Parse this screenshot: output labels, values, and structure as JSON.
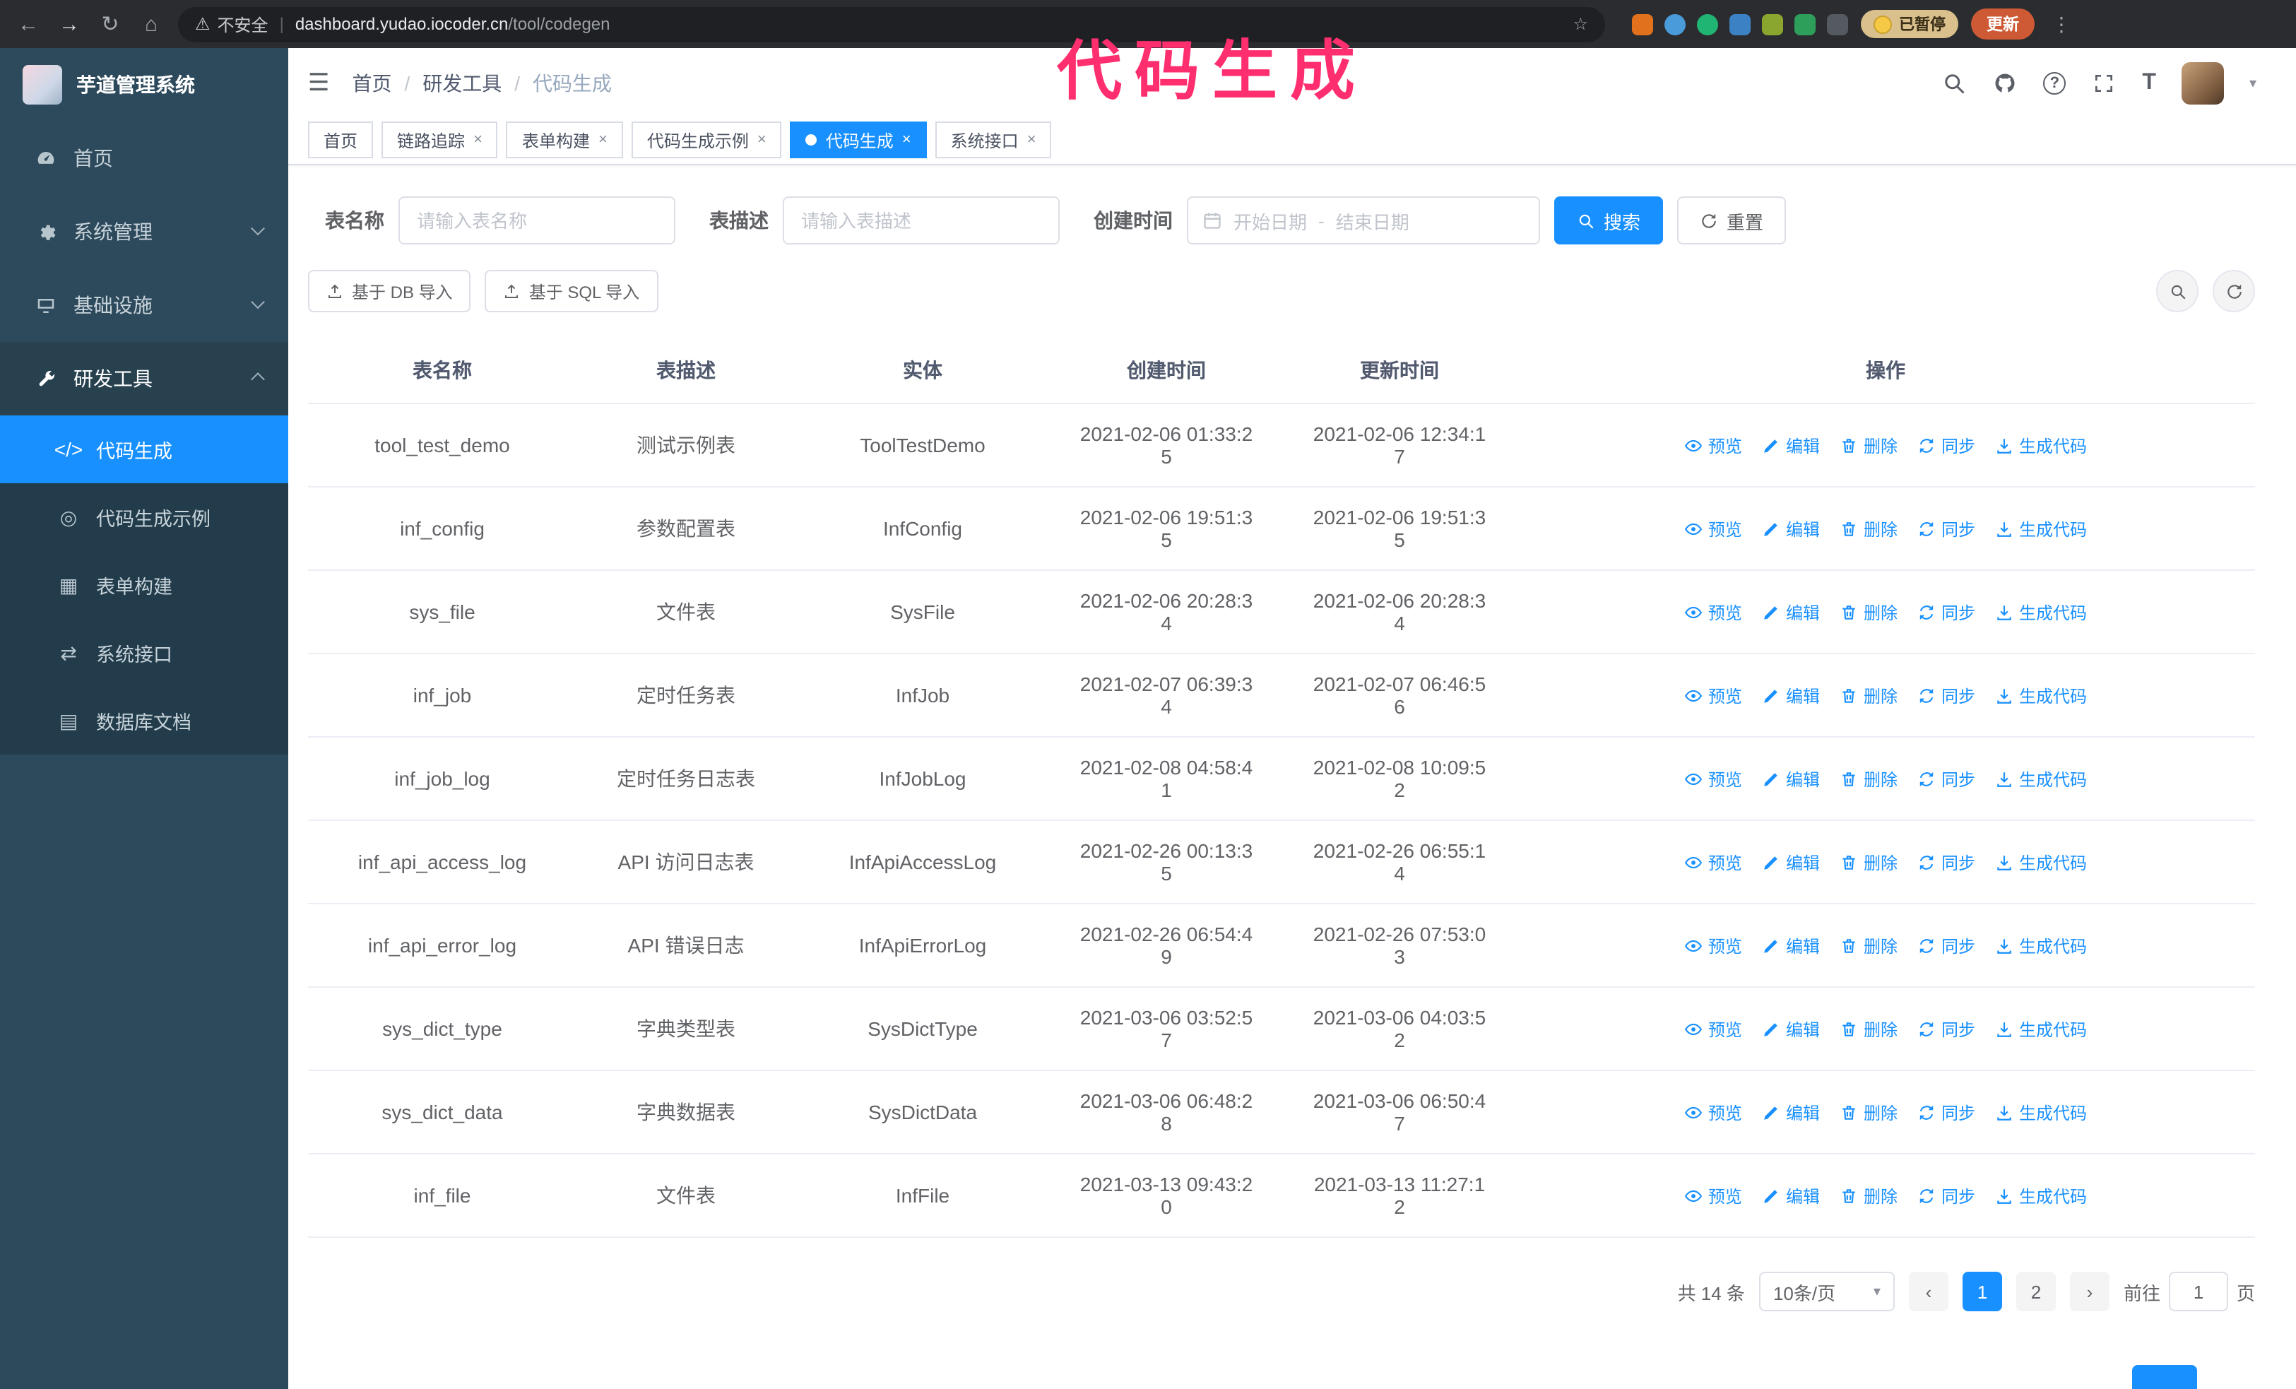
{
  "browser": {
    "warning_text": "不安全",
    "url_host": "dashboard.yudao.iocoder.cn",
    "url_path": "/tool/codegen",
    "paused_badge": "已暂停",
    "update_button": "更新",
    "extensions": [
      "#e2711d",
      "#4a9bd9",
      "#21b573",
      "#3b82c4",
      "#8aa62f",
      "#2e9e5b",
      "#555a60"
    ]
  },
  "annotation": {
    "text": "代码生成",
    "color": "#ff2e6e"
  },
  "sidebar": {
    "logo_title": "芋道管理系统",
    "items": [
      {
        "label": "首页",
        "icon": "dashboard"
      },
      {
        "label": "系统管理",
        "icon": "gear",
        "chevron": "down"
      },
      {
        "label": "基础设施",
        "icon": "infra",
        "chevron": "down"
      },
      {
        "label": "研发工具",
        "icon": "tools",
        "chevron": "up"
      }
    ],
    "subitems": [
      {
        "label": "代码生成",
        "icon": "code",
        "active": true
      },
      {
        "label": "代码生成示例",
        "icon": "example"
      },
      {
        "label": "表单构建",
        "icon": "form"
      },
      {
        "label": "系统接口",
        "icon": "api"
      },
      {
        "label": "数据库文档",
        "icon": "db"
      }
    ]
  },
  "header": {
    "breadcrumb": [
      "首页",
      "研发工具",
      "代码生成"
    ]
  },
  "tabs": [
    {
      "label": "首页",
      "closable": false
    },
    {
      "label": "链路追踪",
      "closable": true
    },
    {
      "label": "表单构建",
      "closable": true
    },
    {
      "label": "代码生成示例",
      "closable": true
    },
    {
      "label": "代码生成",
      "closable": true,
      "active": true
    },
    {
      "label": "系统接口",
      "closable": true
    }
  ],
  "filters": {
    "table_name_label": "表名称",
    "table_name_placeholder": "请输入表名称",
    "table_desc_label": "表描述",
    "table_desc_placeholder": "请输入表描述",
    "create_time_label": "创建时间",
    "date_start_placeholder": "开始日期",
    "date_separator": "-",
    "date_end_placeholder": "结束日期",
    "search_button": "搜索",
    "reset_button": "重置"
  },
  "toolbar": {
    "import_db_button": "基于 DB 导入",
    "import_sql_button": "基于 SQL 导入"
  },
  "table": {
    "columns": [
      "表名称",
      "表描述",
      "实体",
      "创建时间",
      "更新时间",
      "操作"
    ],
    "actions": [
      "预览",
      "编辑",
      "删除",
      "同步",
      "生成代码"
    ],
    "rows": [
      {
        "name": "tool_test_demo",
        "desc": "测试示例表",
        "entity": "ToolTestDemo",
        "created": "2021-02-06 01:33:25",
        "updated": "2021-02-06 12:34:17"
      },
      {
        "name": "inf_config",
        "desc": "参数配置表",
        "entity": "InfConfig",
        "created": "2021-02-06 19:51:35",
        "updated": "2021-02-06 19:51:35"
      },
      {
        "name": "sys_file",
        "desc": "文件表",
        "entity": "SysFile",
        "created": "2021-02-06 20:28:34",
        "updated": "2021-02-06 20:28:34"
      },
      {
        "name": "inf_job",
        "desc": "定时任务表",
        "entity": "InfJob",
        "created": "2021-02-07 06:39:34",
        "updated": "2021-02-07 06:46:56"
      },
      {
        "name": "inf_job_log",
        "desc": "定时任务日志表",
        "entity": "InfJobLog",
        "created": "2021-02-08 04:58:41",
        "updated": "2021-02-08 10:09:52"
      },
      {
        "name": "inf_api_access_log",
        "desc": "API 访问日志表",
        "entity": "InfApiAccessLog",
        "created": "2021-02-26 00:13:35",
        "updated": "2021-02-26 06:55:14"
      },
      {
        "name": "inf_api_error_log",
        "desc": "API 错误日志",
        "entity": "InfApiErrorLog",
        "created": "2021-02-26 06:54:49",
        "updated": "2021-02-26 07:53:03"
      },
      {
        "name": "sys_dict_type",
        "desc": "字典类型表",
        "entity": "SysDictType",
        "created": "2021-03-06 03:52:57",
        "updated": "2021-03-06 04:03:52"
      },
      {
        "name": "sys_dict_data",
        "desc": "字典数据表",
        "entity": "SysDictData",
        "created": "2021-03-06 06:48:28",
        "updated": "2021-03-06 06:50:47"
      },
      {
        "name": "inf_file",
        "desc": "文件表",
        "entity": "InfFile",
        "created": "2021-03-13 09:43:20",
        "updated": "2021-03-13 11:27:12"
      }
    ]
  },
  "pagination": {
    "total": "共 14 条",
    "page_size": "10条/页",
    "pages": [
      "1",
      "2"
    ],
    "active_page": "1",
    "goto_label": "前往",
    "goto_value": "1",
    "goto_suffix": "页"
  }
}
